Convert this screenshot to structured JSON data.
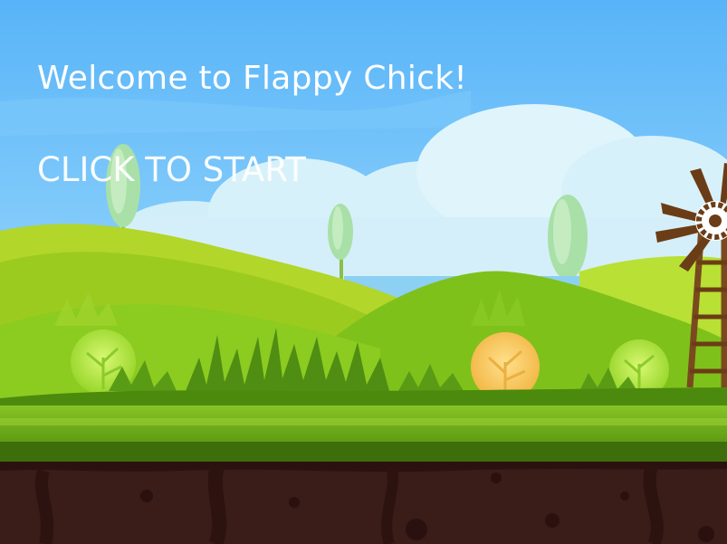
{
  "game": {
    "welcome_text": "Welcome to Flappy Chick!",
    "start_text": "CLICK TO START"
  },
  "palette": {
    "sky": "#5ab5f8",
    "cloud": "#d4eff9",
    "hill_far": "#8fc82a",
    "hill_near": "#6fb31b",
    "grass_strip": "#7cbb1a",
    "grass_dark": "#3e6d0b",
    "soil": "#3a1c18",
    "bush_green": "#b8e944",
    "bush_orange": "#f6c55a",
    "windmill_wood": "#6b3d16"
  },
  "scene_objects": [
    "cloud",
    "tree",
    "hill",
    "bush",
    "grass-tuft",
    "windmill",
    "ground",
    "soil"
  ]
}
